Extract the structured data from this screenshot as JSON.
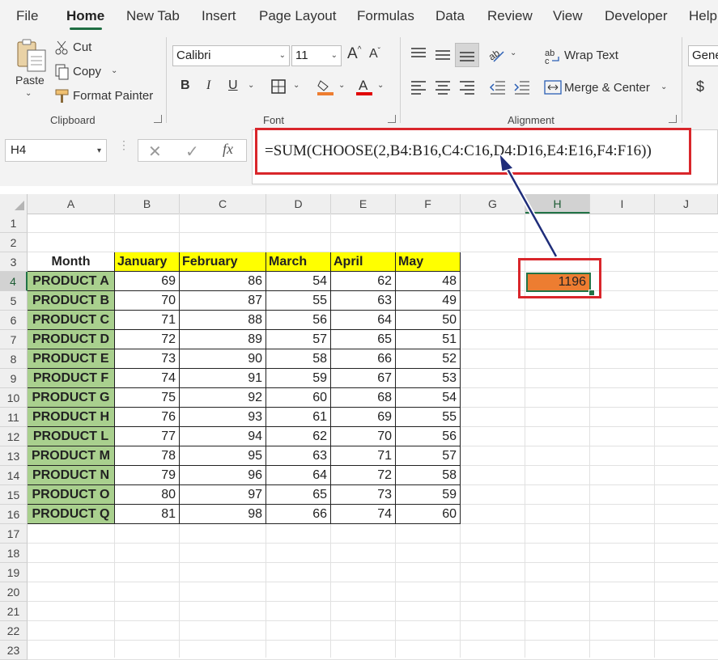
{
  "menu": {
    "items": [
      "File",
      "Home",
      "New Tab",
      "Insert",
      "Page Layout",
      "Formulas",
      "Data",
      "Review",
      "View",
      "Developer",
      "Help"
    ],
    "active": "Home"
  },
  "clipboard": {
    "paste_label": "Paste",
    "cut_label": "Cut",
    "copy_label": "Copy",
    "format_painter_label": "Format Painter",
    "group_label": "Clipboard"
  },
  "font": {
    "font_name": "Calibri",
    "font_size": "11",
    "bold": "B",
    "italic": "I",
    "underline": "U",
    "group_label": "Font"
  },
  "alignment": {
    "wrap_text_label": "Wrap Text",
    "merge_center_label": "Merge & Center",
    "group_label": "Alignment"
  },
  "number": {
    "format_label": "Gene",
    "currency_symbol": "$"
  },
  "formula_bar": {
    "name_box": "H4",
    "fx_label": "fx",
    "formula": "=SUM(CHOOSE(2,B4:B16,C4:C16,D4:D16,E4:E16,F4:F16))"
  },
  "sheet": {
    "columns": [
      "A",
      "B",
      "C",
      "D",
      "E",
      "F",
      "G",
      "H",
      "I",
      "J"
    ],
    "selected_column": "H",
    "selected_row": 4,
    "row_numbers": [
      1,
      2,
      3,
      4,
      5,
      6,
      7,
      8,
      9,
      10,
      11,
      12,
      13,
      14,
      15,
      16,
      17,
      18,
      19,
      20,
      21,
      22,
      23
    ],
    "table": {
      "header_label": "Month",
      "months": [
        "January",
        "February",
        "March",
        "April",
        "May"
      ],
      "rows": [
        {
          "product": "PRODUCT A",
          "values": [
            69,
            86,
            54,
            62,
            48
          ]
        },
        {
          "product": "PRODUCT B",
          "values": [
            70,
            87,
            55,
            63,
            49
          ]
        },
        {
          "product": "PRODUCT C",
          "values": [
            71,
            88,
            56,
            64,
            50
          ]
        },
        {
          "product": "PRODUCT D",
          "values": [
            72,
            89,
            57,
            65,
            51
          ]
        },
        {
          "product": "PRODUCT E",
          "values": [
            73,
            90,
            58,
            66,
            52
          ]
        },
        {
          "product": "PRODUCT F",
          "values": [
            74,
            91,
            59,
            67,
            53
          ]
        },
        {
          "product": "PRODUCT G",
          "values": [
            75,
            92,
            60,
            68,
            54
          ]
        },
        {
          "product": "PRODUCT H",
          "values": [
            76,
            93,
            61,
            69,
            55
          ]
        },
        {
          "product": "PRODUCT L",
          "values": [
            77,
            94,
            62,
            70,
            56
          ]
        },
        {
          "product": "PRODUCT M",
          "values": [
            78,
            95,
            63,
            71,
            57
          ]
        },
        {
          "product": "PRODUCT N",
          "values": [
            79,
            96,
            64,
            72,
            58
          ]
        },
        {
          "product": "PRODUCT O",
          "values": [
            80,
            97,
            65,
            73,
            59
          ]
        },
        {
          "product": "PRODUCT Q",
          "values": [
            81,
            98,
            66,
            74,
            60
          ]
        }
      ]
    },
    "result_cell_value": "1196"
  },
  "colors": {
    "accent_green": "#217346",
    "header_yellow": "#ffff00",
    "product_green": "#a9d08e",
    "result_orange": "#ed7d31",
    "highlight_red": "#d9262b",
    "arrow_navy": "#1f2d7a"
  }
}
